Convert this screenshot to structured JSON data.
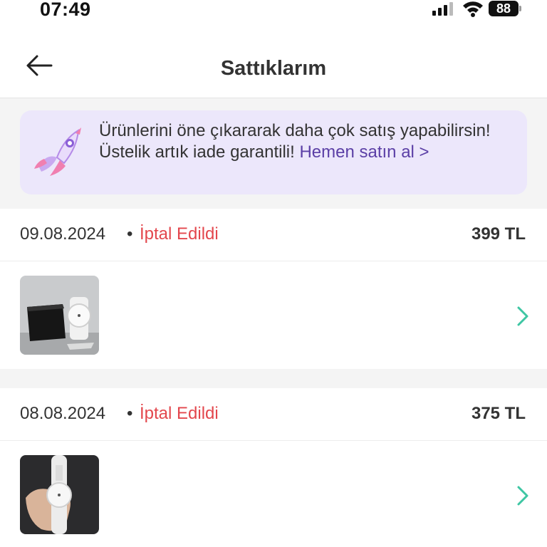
{
  "status_bar": {
    "time": "07:49",
    "battery": "88"
  },
  "header": {
    "title": "Sattıklarım",
    "back_icon": "arrow-left-icon"
  },
  "promo": {
    "text": "Ürünlerini öne çıkararak daha çok satış yapabilirsin! Üstelik artık iade garantili! ",
    "link": "Hemen satın al >",
    "icon": "rocket-icon"
  },
  "orders": [
    {
      "date": "09.08.2024",
      "separator": "•",
      "status": "İptal Edildi",
      "price": "399 TL",
      "thumb_icon": "watch-with-box-photo"
    },
    {
      "date": "08.08.2024",
      "separator": "•",
      "status": "İptal Edildi",
      "price": "375 TL",
      "thumb_icon": "watch-on-hand-photo"
    }
  ],
  "colors": {
    "accent": "#5b3fa6",
    "status_cancelled": "#e3474d",
    "chevron": "#3ec6a3",
    "promo_bg": "#ece7fb"
  }
}
